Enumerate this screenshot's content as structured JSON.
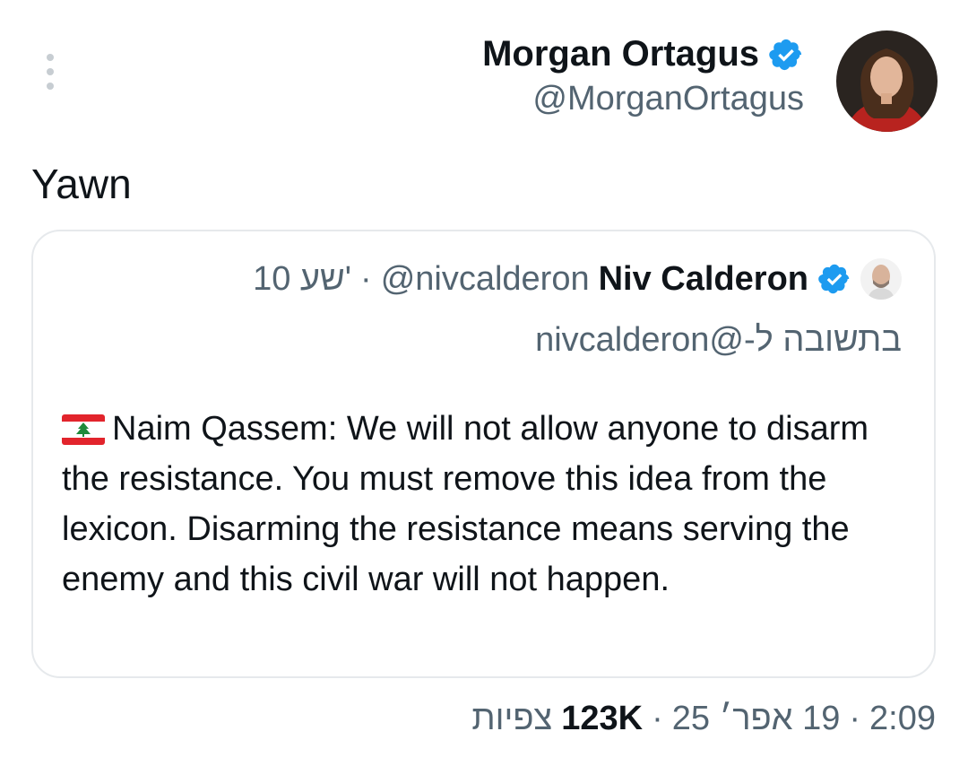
{
  "author": {
    "name": "Morgan Ortagus",
    "handle": "@MorganOrtagus"
  },
  "tweet": {
    "text": "Yawn"
  },
  "quote": {
    "name": "Niv Calderon",
    "handle": "@nivcalderon",
    "separator": "·",
    "time": "10 שע'",
    "reply_to": "בתשובה ל-@nivcalderon",
    "body": "Naim Qassem: We will not allow anyone to disarm the resistance. You must remove this idea from the lexicon. Disarming the resistance means serving the enemy and this civil war will not happen."
  },
  "footer": {
    "time": "2:09",
    "date": "19 אפר׳ 25",
    "views_count": "123K",
    "views_label": "צפיות",
    "separator": "·"
  },
  "colors": {
    "verified": "#1d9bf0",
    "text": "#0f1419",
    "muted": "#536471"
  },
  "icons": [
    "more-vertical-icon",
    "verified-badge-icon",
    "lebanon-flag-icon"
  ]
}
